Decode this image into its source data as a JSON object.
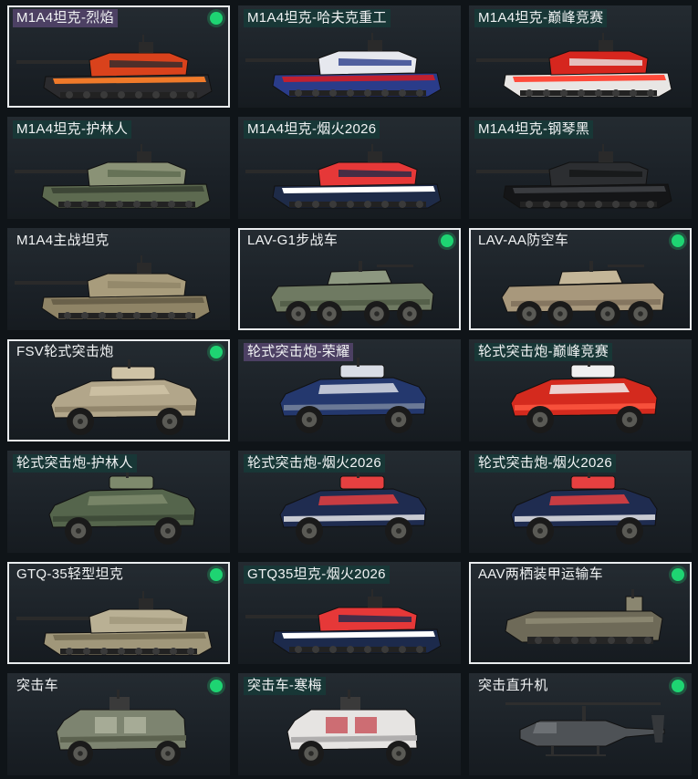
{
  "cards": [
    {
      "label": "M1A4坦克-烈焰",
      "selected": true,
      "badge": true,
      "tag": "purple",
      "kind": "tank",
      "body": "#2b2b2e",
      "accent": "#d9421c",
      "stripe": "#f07a2a"
    },
    {
      "label": "M1A4坦克-哈夫克重工",
      "selected": false,
      "badge": false,
      "tag": "teal",
      "kind": "tank",
      "body": "#2a3c8a",
      "accent": "#e6e8ee",
      "stripe": "#c02030"
    },
    {
      "label": "M1A4坦克-巅峰竞赛",
      "selected": false,
      "badge": false,
      "tag": "teal",
      "kind": "tank",
      "body": "#e8e6e4",
      "accent": "#d6261e",
      "stripe": "#ff4a3a"
    },
    {
      "label": "M1A4坦克-护林人",
      "selected": false,
      "badge": false,
      "tag": "teal",
      "kind": "tank",
      "body": "#5d6a50",
      "accent": "#8a9276",
      "stripe": "#3d4636"
    },
    {
      "label": "M1A4坦克-烟火2026",
      "selected": false,
      "badge": false,
      "tag": "teal",
      "kind": "tank",
      "body": "#1e2b48",
      "accent": "#e63838",
      "stripe": "#ffffff"
    },
    {
      "label": "M1A4坦克-钢琴黑",
      "selected": false,
      "badge": false,
      "tag": "teal",
      "kind": "tank",
      "body": "#141517",
      "accent": "#2c2e31",
      "stripe": "#3a3c40"
    },
    {
      "label": "M1A4主战坦克",
      "selected": false,
      "badge": false,
      "tag": "none",
      "kind": "tank",
      "body": "#8f8466",
      "accent": "#a89c7c",
      "stripe": "#6a614a"
    },
    {
      "label": "LAV-G1步战车",
      "selected": true,
      "badge": true,
      "tag": "none",
      "kind": "lav",
      "body": "#6f7a62",
      "accent": "#8d9880",
      "stripe": "#55604a"
    },
    {
      "label": "LAV-AA防空车",
      "selected": true,
      "badge": true,
      "tag": "none",
      "kind": "lav",
      "body": "#a8987c",
      "accent": "#c4b698",
      "stripe": "#857660"
    },
    {
      "label": "FSV轮式突击炮",
      "selected": true,
      "badge": true,
      "tag": "none",
      "kind": "fsv",
      "body": "#b2a68a",
      "accent": "#cfc3a6",
      "stripe": "#8a7e64"
    },
    {
      "label": "轮式突击炮-荣耀",
      "selected": false,
      "badge": false,
      "tag": "purple",
      "kind": "fsv",
      "body": "#24386e",
      "accent": "#d9dde6",
      "stripe": "#7d8aa0"
    },
    {
      "label": "轮式突击炮-巅峰竞赛",
      "selected": false,
      "badge": false,
      "tag": "teal",
      "kind": "fsv",
      "body": "#d42a1e",
      "accent": "#f0f0f0",
      "stripe": "#ff5a42"
    },
    {
      "label": "轮式突击炮-护林人",
      "selected": false,
      "badge": false,
      "tag": "teal",
      "kind": "fsv",
      "body": "#55654c",
      "accent": "#7e8a6c",
      "stripe": "#3a4634"
    },
    {
      "label": "轮式突击炮-烟火2026",
      "selected": false,
      "badge": false,
      "tag": "teal",
      "kind": "fsv",
      "body": "#1f2c50",
      "accent": "#e64040",
      "stripe": "#f2f2f2"
    },
    {
      "label": "轮式突击炮-烟火2026",
      "selected": false,
      "badge": false,
      "tag": "teal",
      "kind": "fsv",
      "body": "#1f2c50",
      "accent": "#e64040",
      "stripe": "#f2f2f2"
    },
    {
      "label": "GTQ-35轻型坦克",
      "selected": true,
      "badge": true,
      "tag": "none",
      "kind": "tank",
      "body": "#a0977a",
      "accent": "#b9b094",
      "stripe": "#7a7258"
    },
    {
      "label": "GTQ35坦克-烟火2026",
      "selected": false,
      "badge": false,
      "tag": "teal",
      "kind": "tank",
      "body": "#1c2a4c",
      "accent": "#e63838",
      "stripe": "#ffffff"
    },
    {
      "label": "AAV两栖装甲运输车",
      "selected": true,
      "badge": true,
      "tag": "none",
      "kind": "aav",
      "body": "#6e6a58",
      "accent": "#8a8670",
      "stripe": "#54503f"
    },
    {
      "label": "突击车",
      "selected": false,
      "badge": true,
      "tag": "none",
      "kind": "mrap",
      "body": "#7d8470",
      "accent": "#b8bca6",
      "stripe": "#5c624f"
    },
    {
      "label": "突击车-寒梅",
      "selected": false,
      "badge": false,
      "tag": "teal",
      "kind": "mrap",
      "body": "#e6e4e2",
      "accent": "#c23a44",
      "stripe": "#b0aeae"
    },
    {
      "label": "突击直升机",
      "selected": false,
      "badge": true,
      "tag": "none",
      "kind": "heli",
      "body": "#4e5256",
      "accent": "#6c7074",
      "stripe": "#35383b"
    }
  ]
}
